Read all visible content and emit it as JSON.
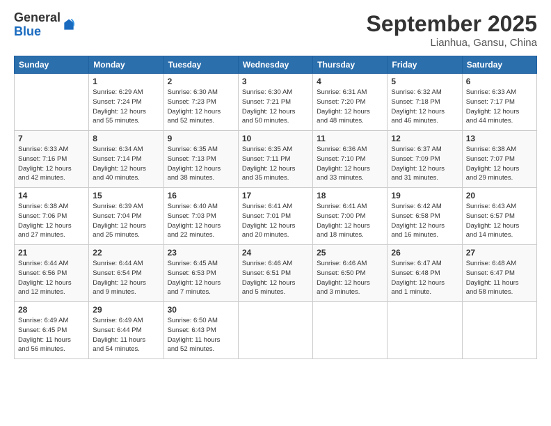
{
  "logo": {
    "general": "General",
    "blue": "Blue"
  },
  "header": {
    "title": "September 2025",
    "location": "Lianhua, Gansu, China"
  },
  "columns": [
    "Sunday",
    "Monday",
    "Tuesday",
    "Wednesday",
    "Thursday",
    "Friday",
    "Saturday"
  ],
  "weeks": [
    [
      {
        "day": "",
        "info": ""
      },
      {
        "day": "1",
        "info": "Sunrise: 6:29 AM\nSunset: 7:24 PM\nDaylight: 12 hours\nand 55 minutes."
      },
      {
        "day": "2",
        "info": "Sunrise: 6:30 AM\nSunset: 7:23 PM\nDaylight: 12 hours\nand 52 minutes."
      },
      {
        "day": "3",
        "info": "Sunrise: 6:30 AM\nSunset: 7:21 PM\nDaylight: 12 hours\nand 50 minutes."
      },
      {
        "day": "4",
        "info": "Sunrise: 6:31 AM\nSunset: 7:20 PM\nDaylight: 12 hours\nand 48 minutes."
      },
      {
        "day": "5",
        "info": "Sunrise: 6:32 AM\nSunset: 7:18 PM\nDaylight: 12 hours\nand 46 minutes."
      },
      {
        "day": "6",
        "info": "Sunrise: 6:33 AM\nSunset: 7:17 PM\nDaylight: 12 hours\nand 44 minutes."
      }
    ],
    [
      {
        "day": "7",
        "info": "Sunrise: 6:33 AM\nSunset: 7:16 PM\nDaylight: 12 hours\nand 42 minutes."
      },
      {
        "day": "8",
        "info": "Sunrise: 6:34 AM\nSunset: 7:14 PM\nDaylight: 12 hours\nand 40 minutes."
      },
      {
        "day": "9",
        "info": "Sunrise: 6:35 AM\nSunset: 7:13 PM\nDaylight: 12 hours\nand 38 minutes."
      },
      {
        "day": "10",
        "info": "Sunrise: 6:35 AM\nSunset: 7:11 PM\nDaylight: 12 hours\nand 35 minutes."
      },
      {
        "day": "11",
        "info": "Sunrise: 6:36 AM\nSunset: 7:10 PM\nDaylight: 12 hours\nand 33 minutes."
      },
      {
        "day": "12",
        "info": "Sunrise: 6:37 AM\nSunset: 7:09 PM\nDaylight: 12 hours\nand 31 minutes."
      },
      {
        "day": "13",
        "info": "Sunrise: 6:38 AM\nSunset: 7:07 PM\nDaylight: 12 hours\nand 29 minutes."
      }
    ],
    [
      {
        "day": "14",
        "info": "Sunrise: 6:38 AM\nSunset: 7:06 PM\nDaylight: 12 hours\nand 27 minutes."
      },
      {
        "day": "15",
        "info": "Sunrise: 6:39 AM\nSunset: 7:04 PM\nDaylight: 12 hours\nand 25 minutes."
      },
      {
        "day": "16",
        "info": "Sunrise: 6:40 AM\nSunset: 7:03 PM\nDaylight: 12 hours\nand 22 minutes."
      },
      {
        "day": "17",
        "info": "Sunrise: 6:41 AM\nSunset: 7:01 PM\nDaylight: 12 hours\nand 20 minutes."
      },
      {
        "day": "18",
        "info": "Sunrise: 6:41 AM\nSunset: 7:00 PM\nDaylight: 12 hours\nand 18 minutes."
      },
      {
        "day": "19",
        "info": "Sunrise: 6:42 AM\nSunset: 6:58 PM\nDaylight: 12 hours\nand 16 minutes."
      },
      {
        "day": "20",
        "info": "Sunrise: 6:43 AM\nSunset: 6:57 PM\nDaylight: 12 hours\nand 14 minutes."
      }
    ],
    [
      {
        "day": "21",
        "info": "Sunrise: 6:44 AM\nSunset: 6:56 PM\nDaylight: 12 hours\nand 12 minutes."
      },
      {
        "day": "22",
        "info": "Sunrise: 6:44 AM\nSunset: 6:54 PM\nDaylight: 12 hours\nand 9 minutes."
      },
      {
        "day": "23",
        "info": "Sunrise: 6:45 AM\nSunset: 6:53 PM\nDaylight: 12 hours\nand 7 minutes."
      },
      {
        "day": "24",
        "info": "Sunrise: 6:46 AM\nSunset: 6:51 PM\nDaylight: 12 hours\nand 5 minutes."
      },
      {
        "day": "25",
        "info": "Sunrise: 6:46 AM\nSunset: 6:50 PM\nDaylight: 12 hours\nand 3 minutes."
      },
      {
        "day": "26",
        "info": "Sunrise: 6:47 AM\nSunset: 6:48 PM\nDaylight: 12 hours\nand 1 minute."
      },
      {
        "day": "27",
        "info": "Sunrise: 6:48 AM\nSunset: 6:47 PM\nDaylight: 11 hours\nand 58 minutes."
      }
    ],
    [
      {
        "day": "28",
        "info": "Sunrise: 6:49 AM\nSunset: 6:45 PM\nDaylight: 11 hours\nand 56 minutes."
      },
      {
        "day": "29",
        "info": "Sunrise: 6:49 AM\nSunset: 6:44 PM\nDaylight: 11 hours\nand 54 minutes."
      },
      {
        "day": "30",
        "info": "Sunrise: 6:50 AM\nSunset: 6:43 PM\nDaylight: 11 hours\nand 52 minutes."
      },
      {
        "day": "",
        "info": ""
      },
      {
        "day": "",
        "info": ""
      },
      {
        "day": "",
        "info": ""
      },
      {
        "day": "",
        "info": ""
      }
    ]
  ]
}
